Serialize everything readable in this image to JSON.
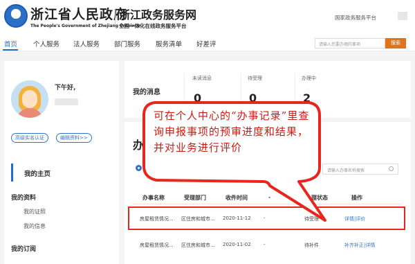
{
  "header": {
    "gov_name": "浙江省人民政府",
    "gov_name_en": "The People's Government of Zhejiang Province",
    "platform_title": "浙江政务服务网",
    "platform_subtitle": "全国一体化在线政务服务平台",
    "national_platform_link": "国家政务服务平台"
  },
  "nav": {
    "items": [
      "首页",
      "个人服务",
      "法人服务",
      "部门服务",
      "服务清单",
      "好差评"
    ],
    "active_index": 0,
    "search_placeholder": "请输入您要办理的事项",
    "search_button": "搜索"
  },
  "sidebar": {
    "greeting": "下午好,",
    "badges": [
      "高级实名认证",
      "编辑资料>>"
    ],
    "home_label": "我的主页",
    "sections": [
      {
        "title": "我的资料",
        "items": [
          "我的证照",
          "我的信息"
        ]
      },
      {
        "title": "我的订阅",
        "items": []
      }
    ]
  },
  "messages": {
    "title": "我的消息",
    "columns": [
      {
        "label": "未读消息",
        "value": "0"
      },
      {
        "label": "待受理",
        "value": "0"
      },
      {
        "label": "办理中",
        "value": "2"
      }
    ]
  },
  "records": {
    "title": "办",
    "search_placeholder": "请输入办事名称搜索",
    "headers": [
      "办事名称",
      "受理部门",
      "收件时间",
      "-",
      "办理状态",
      "操作"
    ],
    "rows": [
      {
        "name": "房屋租赁情况...",
        "dept": "区住房和城市...",
        "date": "2020-11-12",
        "dash": "-",
        "status": "待受理",
        "action": "详情|评价"
      },
      {
        "name": "房屋租赁情况...",
        "dept": "区住房和城市...",
        "date": "2020-11-02",
        "dash": "-",
        "status": "待补件",
        "action": "补齐补正|详情"
      }
    ]
  },
  "callout": {
    "text": "可在个人中心的“办事记录”里查询申报事项的预审进度和结果，并对业务进行评价",
    "color": "#e8261d"
  },
  "colors": {
    "accent": "#1f6fc9",
    "search_button": "#e07418",
    "highlight": "#e8261d"
  }
}
